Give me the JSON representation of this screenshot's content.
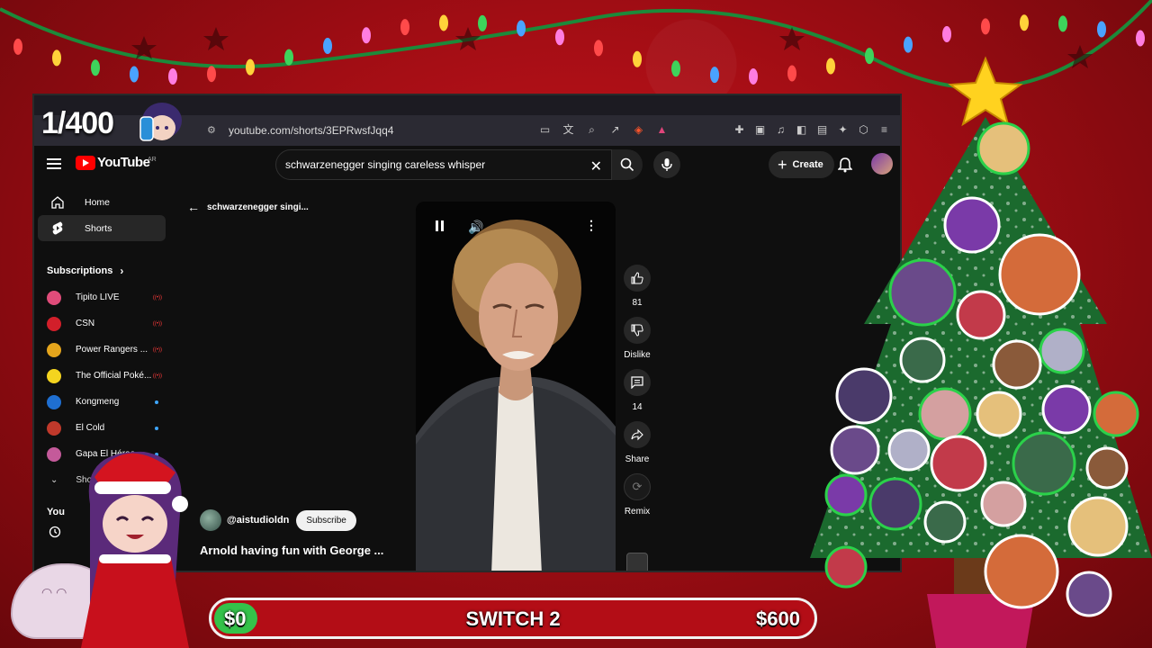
{
  "stream": {
    "counter": "1/400",
    "goal": {
      "start": "$0",
      "name": "SWITCH 2",
      "end": "$600",
      "progress_fraction": 0.0
    }
  },
  "browser": {
    "url": "youtube.com/shorts/3EPRwsfJqq4"
  },
  "youtube": {
    "logo": "YouTube",
    "logo_region": "AR",
    "search_value": "schwarzenegger singing careless whisper",
    "create_label": "Create",
    "nav": [
      {
        "label": "Home",
        "icon": "home-icon"
      },
      {
        "label": "Shorts",
        "icon": "shorts-icon"
      }
    ],
    "subscriptions_title": "Subscriptions",
    "subscriptions": [
      {
        "name": "Tipito LIVE",
        "color": "#e04c7a",
        "status": "live"
      },
      {
        "name": "CSN",
        "color": "#d21f2a",
        "status": "live"
      },
      {
        "name": "Power Rangers ...",
        "color": "#e5a51c",
        "status": "live"
      },
      {
        "name": "The Official Poké...",
        "color": "#f4d41f",
        "status": "live"
      },
      {
        "name": "Kongmeng",
        "color": "#1f6fd1",
        "status": "new"
      },
      {
        "name": "El Cold",
        "color": "#c0392b",
        "status": "new"
      },
      {
        "name": "Gapa El Héroe",
        "color": "#c45a9a",
        "status": "new"
      }
    ],
    "show_more": "Show more",
    "you_title": "You",
    "shorts": {
      "back_title": "schwarzenegger singi...",
      "channel": "@aistudioldn",
      "subscribe_label": "Subscribe",
      "title": "Arnold having fun with George ...",
      "likes": "81",
      "dislike_label": "Dislike",
      "comments": "14",
      "share_label": "Share",
      "remix_label": "Remix"
    }
  },
  "colors": {
    "background": "#a10d14",
    "youtube_red": "#ff0000",
    "goal_fill": "#34c24a",
    "live_badge": "#ff3b3b",
    "new_dot": "#3ea6ff"
  }
}
